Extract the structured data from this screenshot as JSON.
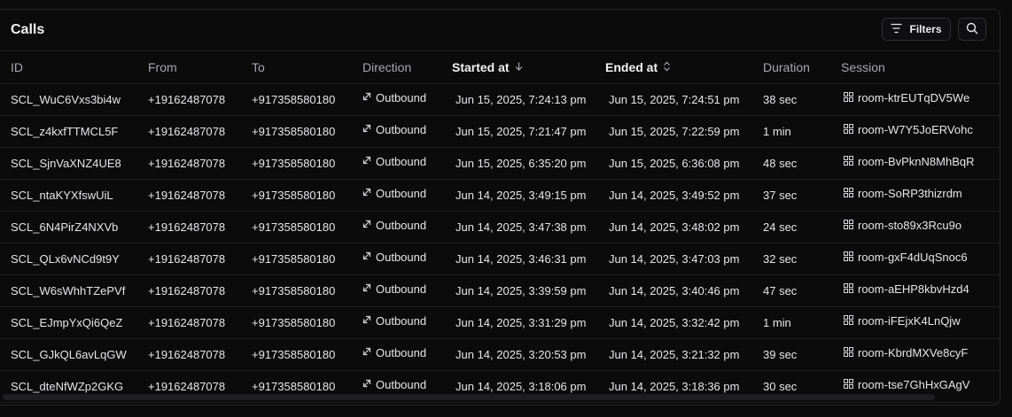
{
  "header": {
    "title": "Calls",
    "filters_label": "Filters"
  },
  "columns": {
    "id": "ID",
    "from": "From",
    "to": "To",
    "direction": "Direction",
    "started_at": "Started at",
    "ended_at": "Ended at",
    "duration": "Duration",
    "session": "Session"
  },
  "icons": {
    "filters": "filter-lines-icon",
    "search": "search-icon",
    "sort_desc": "arrow-down-icon",
    "sort_both": "chevron-up-down-icon",
    "outbound": "outbound-arrow-icon",
    "session": "room-grid-icon"
  },
  "rows": [
    {
      "id": "SCL_WuC6Vxs3bi4w",
      "from": "+19162487078",
      "to": "+917358580180",
      "direction": "Outbound",
      "started": "Jun 15, 2025, 7:24:13 pm",
      "ended": "Jun 15, 2025, 7:24:51 pm",
      "duration": "38 sec",
      "session": "room-ktrEUTqDV5We"
    },
    {
      "id": "SCL_z4kxfTTMCL5F",
      "from": "+19162487078",
      "to": "+917358580180",
      "direction": "Outbound",
      "started": "Jun 15, 2025, 7:21:47 pm",
      "ended": "Jun 15, 2025, 7:22:59 pm",
      "duration": "1 min",
      "session": "room-W7Y5JoERVohc"
    },
    {
      "id": "SCL_SjnVaXNZ4UE8",
      "from": "+19162487078",
      "to": "+917358580180",
      "direction": "Outbound",
      "started": "Jun 15, 2025, 6:35:20 pm",
      "ended": "Jun 15, 2025, 6:36:08 pm",
      "duration": "48 sec",
      "session": "room-BvPknN8MhBqR"
    },
    {
      "id": "SCL_ntaKYXfswUiL",
      "from": "+19162487078",
      "to": "+917358580180",
      "direction": "Outbound",
      "started": "Jun 14, 2025, 3:49:15 pm",
      "ended": "Jun 14, 2025, 3:49:52 pm",
      "duration": "37 sec",
      "session": "room-SoRP3thizrdm"
    },
    {
      "id": "SCL_6N4PirZ4NXVb",
      "from": "+19162487078",
      "to": "+917358580180",
      "direction": "Outbound",
      "started": "Jun 14, 2025, 3:47:38 pm",
      "ended": "Jun 14, 2025, 3:48:02 pm",
      "duration": "24 sec",
      "session": "room-sto89x3Rcu9o"
    },
    {
      "id": "SCL_QLx6vNCd9t9Y",
      "from": "+19162487078",
      "to": "+917358580180",
      "direction": "Outbound",
      "started": "Jun 14, 2025, 3:46:31 pm",
      "ended": "Jun 14, 2025, 3:47:03 pm",
      "duration": "32 sec",
      "session": "room-gxF4dUqSnoc6"
    },
    {
      "id": "SCL_W6sWhhTZePVf",
      "from": "+19162487078",
      "to": "+917358580180",
      "direction": "Outbound",
      "started": "Jun 14, 2025, 3:39:59 pm",
      "ended": "Jun 14, 2025, 3:40:46 pm",
      "duration": "47 sec",
      "session": "room-aEHP8kbvHzd4"
    },
    {
      "id": "SCL_EJmpYxQi6QeZ",
      "from": "+19162487078",
      "to": "+917358580180",
      "direction": "Outbound",
      "started": "Jun 14, 2025, 3:31:29 pm",
      "ended": "Jun 14, 2025, 3:32:42 pm",
      "duration": "1 min",
      "session": "room-iFEjxK4LnQjw"
    },
    {
      "id": "SCL_GJkQL6avLqGW",
      "from": "+19162487078",
      "to": "+917358580180",
      "direction": "Outbound",
      "started": "Jun 14, 2025, 3:20:53 pm",
      "ended": "Jun 14, 2025, 3:21:32 pm",
      "duration": "39 sec",
      "session": "room-KbrdMXVe8cyF"
    },
    {
      "id": "SCL_dteNfWZp2GKG",
      "from": "+19162487078",
      "to": "+917358580180",
      "direction": "Outbound",
      "started": "Jun 14, 2025, 3:18:06 pm",
      "ended": "Jun 14, 2025, 3:18:36 pm",
      "duration": "30 sec",
      "session": "room-tse7GhHxGAgV"
    }
  ]
}
